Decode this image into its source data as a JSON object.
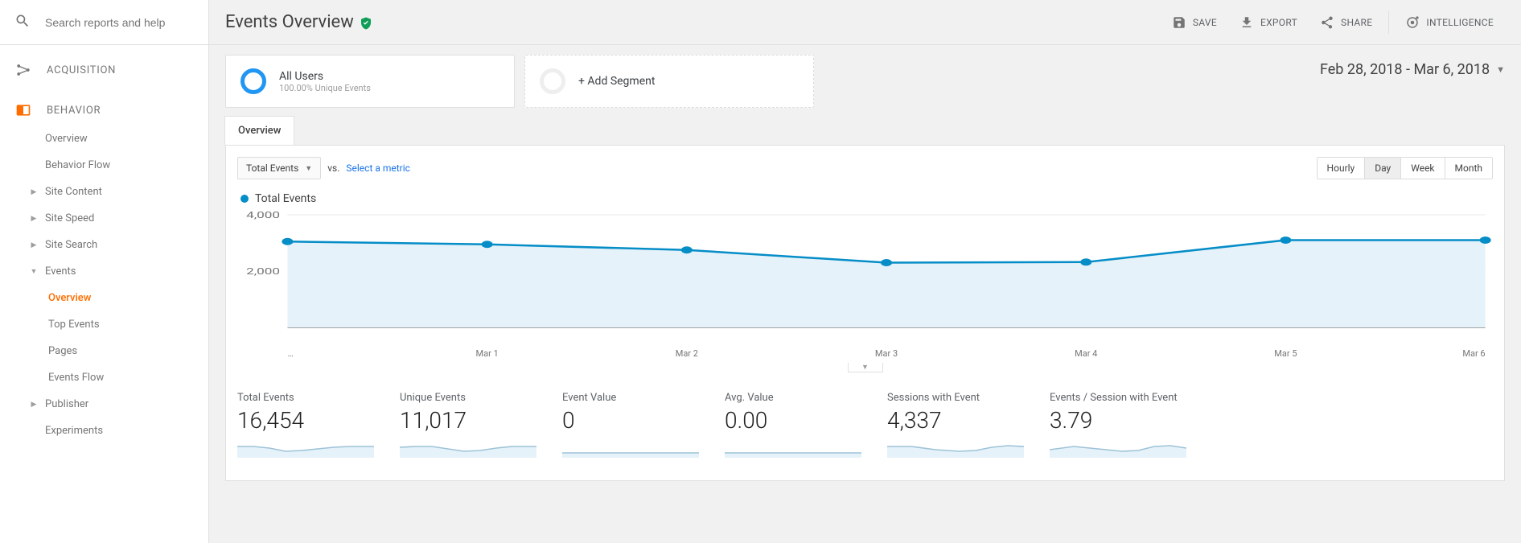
{
  "search": {
    "placeholder": "Search reports and help"
  },
  "nav": {
    "sections": {
      "acquisition": "ACQUISITION",
      "behavior": "BEHAVIOR"
    },
    "behavior_items": {
      "overview": "Overview",
      "behavior_flow": "Behavior Flow",
      "site_content": "Site Content",
      "site_speed": "Site Speed",
      "site_search": "Site Search",
      "events": "Events",
      "events_overview": "Overview",
      "top_events": "Top Events",
      "pages": "Pages",
      "events_flow": "Events Flow",
      "publisher": "Publisher",
      "experiments": "Experiments"
    }
  },
  "header": {
    "title": "Events Overview",
    "save": "SAVE",
    "export": "EXPORT",
    "share": "SHARE",
    "intelligence": "INTELLIGENCE"
  },
  "segments": {
    "all_users": "All Users",
    "all_users_sub": "100.00% Unique Events",
    "add_segment": "+ Add Segment"
  },
  "date_range": "Feb 28, 2018 - Mar 6, 2018",
  "tab": {
    "overview": "Overview"
  },
  "controls": {
    "metric1": "Total Events",
    "vs": "vs.",
    "select_metric": "Select a metric",
    "hourly": "Hourly",
    "day": "Day",
    "week": "Week",
    "month": "Month"
  },
  "chart_legend": "Total Events",
  "chart_data": {
    "type": "line",
    "title": "Total Events",
    "xlabel": "",
    "ylabel": "",
    "ylim": [
      0,
      4000
    ],
    "yticks": [
      2000,
      4000
    ],
    "categories": [
      "…",
      "Mar 1",
      "Mar 2",
      "Mar 3",
      "Mar 4",
      "Mar 5",
      "Mar 6"
    ],
    "series": [
      {
        "name": "Total Events",
        "values": [
          3050,
          2950,
          2750,
          2300,
          2320,
          3100,
          3100
        ]
      }
    ]
  },
  "tiles": [
    {
      "label": "Total Events",
      "value": "16,454"
    },
    {
      "label": "Unique Events",
      "value": "11,017"
    },
    {
      "label": "Event Value",
      "value": "0"
    },
    {
      "label": "Avg. Value",
      "value": "0.00"
    },
    {
      "label": "Sessions with Event",
      "value": "4,337"
    },
    {
      "label": "Events / Session with Event",
      "value": "3.79"
    }
  ]
}
